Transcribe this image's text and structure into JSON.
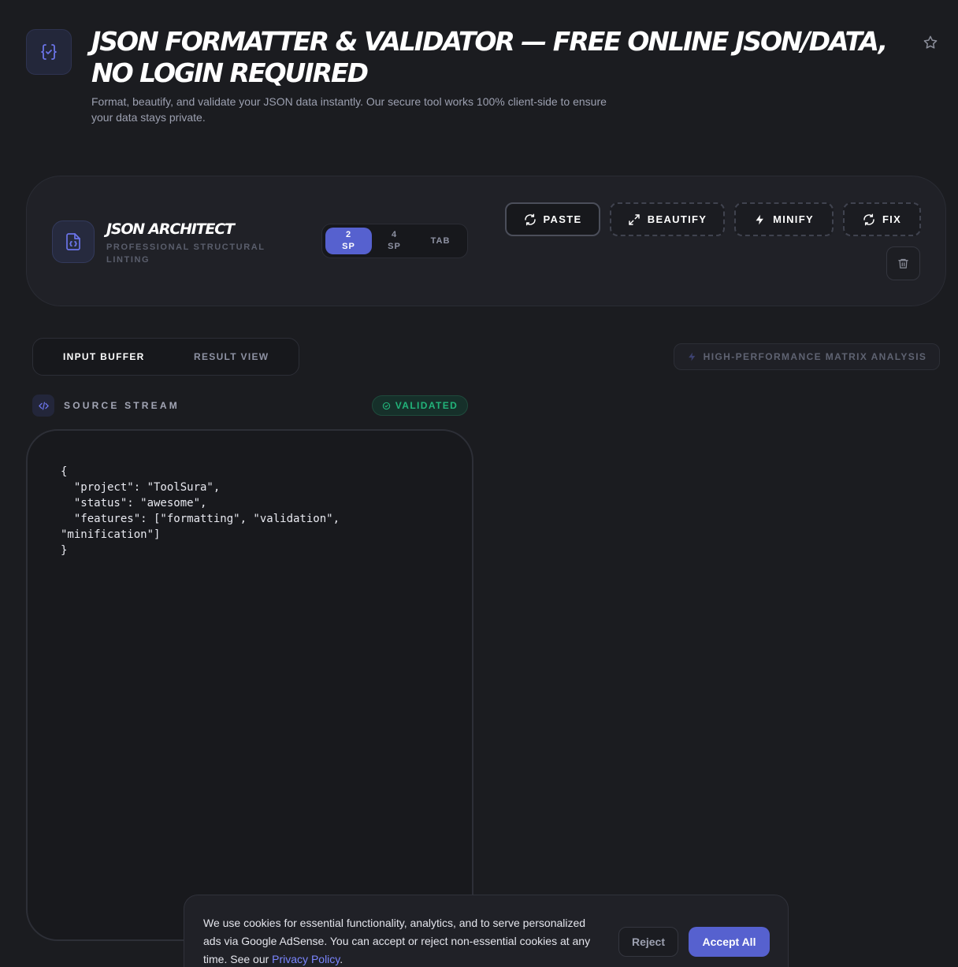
{
  "header": {
    "title": "JSON FORMATTER & VALIDATOR — FREE ONLINE JSON/DATA, NO LOGIN REQUIRED",
    "subtitle": "Format, beautify, and validate your JSON data instantly. Our secure tool works 100% client-side to ensure your data stays private."
  },
  "toolbar": {
    "name": "JSON ARCHITECT",
    "tagline": "PROFESSIONAL STRUCTURAL LINTING",
    "indent_options": [
      {
        "top": "2",
        "bottom": "SP"
      },
      {
        "top": "4",
        "bottom": "SP"
      },
      {
        "top": "TAB",
        "bottom": ""
      }
    ],
    "selected_indent": "2 SP",
    "actions": {
      "paste": "PASTE",
      "beautify": "BEAUTIFY",
      "minify": "MINIFY",
      "fix": "FIX"
    }
  },
  "view_tabs": {
    "input": "INPUT BUFFER",
    "result": "RESULT VIEW",
    "active": "INPUT BUFFER"
  },
  "performance_badge": "HIGH-PERFORMANCE MATRIX ANALYSIS",
  "source": {
    "label": "SOURCE STREAM",
    "status": "VALIDATED",
    "code": "{\n  \"project\": \"ToolSura\",\n  \"status\": \"awesome\",\n  \"features\": [\"formatting\", \"validation\",\n\"minification\"]\n}"
  },
  "cookie": {
    "text": "We use cookies for essential functionality, analytics, and to serve personalized ads via Google AdSense. You can accept or reject non-essential cookies at any time. See our",
    "link": "Privacy Policy",
    "link_suffix": ".",
    "reject": "Reject",
    "accept": "Accept All"
  },
  "colors": {
    "accent": "#5661cf",
    "success": "#22b47a",
    "link": "#7b86ff",
    "background": "#1b1c20"
  }
}
